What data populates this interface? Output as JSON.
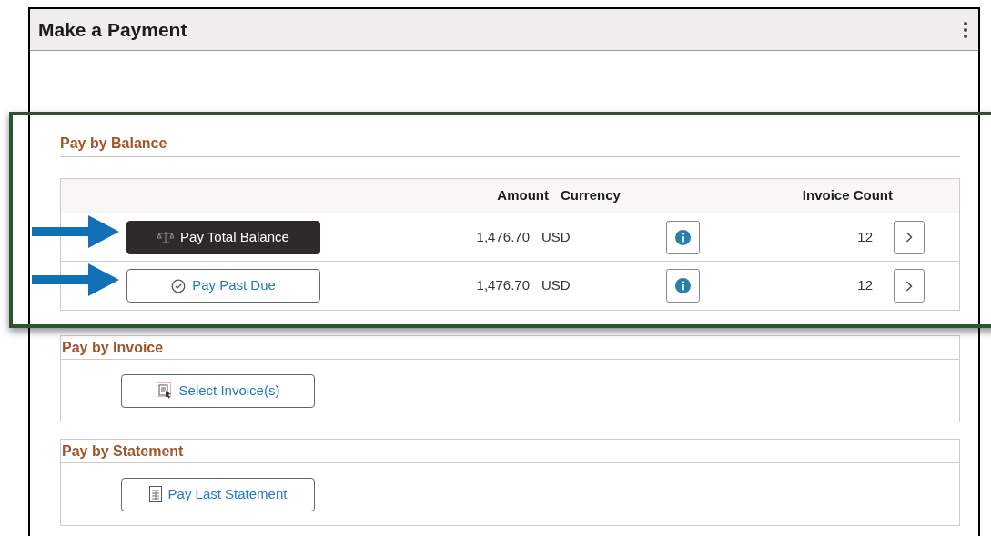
{
  "panel": {
    "title": "Make a Payment"
  },
  "balance": {
    "heading": "Pay by Balance",
    "columns": [
      "Amount",
      "Currency",
      "Invoice Count"
    ],
    "rows": [
      {
        "action": "Pay Total Balance",
        "selected": true,
        "amount": "1,476.70",
        "currency": "USD",
        "invoice_count": "12"
      },
      {
        "action": "Pay Past Due",
        "selected": false,
        "amount": "1,476.70",
        "currency": "USD",
        "invoice_count": "12"
      }
    ]
  },
  "sections": [
    {
      "heading": "Pay by Invoice",
      "button": "Select Invoice(s)"
    },
    {
      "heading": "Pay by Statement",
      "button": "Pay Last Statement"
    }
  ]
}
